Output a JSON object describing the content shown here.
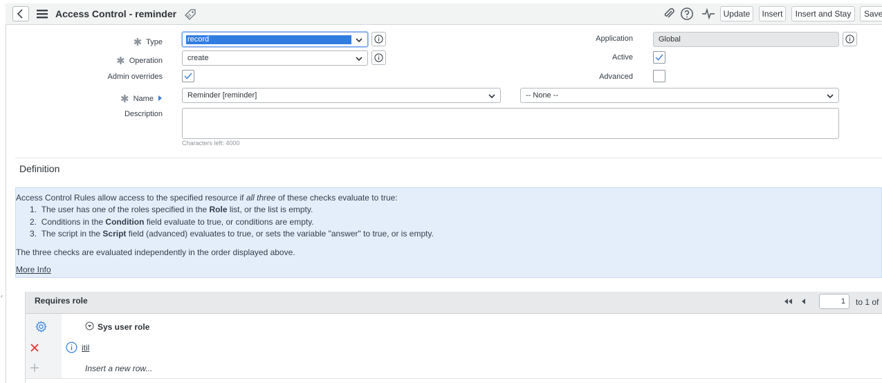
{
  "header": {
    "title": "Access Control - reminder",
    "buttons": {
      "update": "Update",
      "insert": "Insert",
      "insert_stay": "Insert and Stay",
      "save": "Save"
    }
  },
  "form": {
    "type": {
      "label": "Type",
      "value": "record",
      "required": true
    },
    "operation": {
      "label": "Operation",
      "value": "create",
      "required": true
    },
    "admin_overrides": {
      "label": "Admin overrides",
      "checked": true
    },
    "name": {
      "label": "Name",
      "value": "Reminder [reminder]",
      "field_value": "-- None --",
      "required": true
    },
    "description": {
      "label": "Description",
      "value": "",
      "chars_left": "Characters left: 4000"
    },
    "application": {
      "label": "Application",
      "value": "Global"
    },
    "active": {
      "label": "Active",
      "checked": true
    },
    "advanced": {
      "label": "Advanced",
      "checked": false
    }
  },
  "definition": {
    "heading": "Definition",
    "intro_pre": "Access Control Rules allow access to the specified resource if ",
    "intro_em": "all three",
    "intro_post": " of these checks evaluate to true:",
    "items": [
      {
        "num": "1.",
        "pre": "The user has one of the roles specified in the ",
        "bold": "Role",
        "post": " list, or the list is empty."
      },
      {
        "num": "2.",
        "pre": "Conditions in the ",
        "bold": "Condition",
        "post": " field evaluate to true, or conditions are empty."
      },
      {
        "num": "3.",
        "pre": "The script in the ",
        "bold": "Script",
        "post": " field (advanced) evaluates to true, or sets the variable \"answer\" to true, or is empty."
      }
    ],
    "footer": "The three checks are evaluated independently in the order displayed above.",
    "more_info": "More Info"
  },
  "related_list": {
    "title": "Requires role",
    "page_input": "1",
    "page_text": "to 1 of",
    "column": "Sys user role",
    "rows": [
      {
        "value": "itil"
      }
    ],
    "insert_text": "Insert a new row..."
  },
  "colors": {
    "accent": "#2f7de1",
    "delete": "#e52d2d",
    "definition_bg": "#e4eefb"
  }
}
